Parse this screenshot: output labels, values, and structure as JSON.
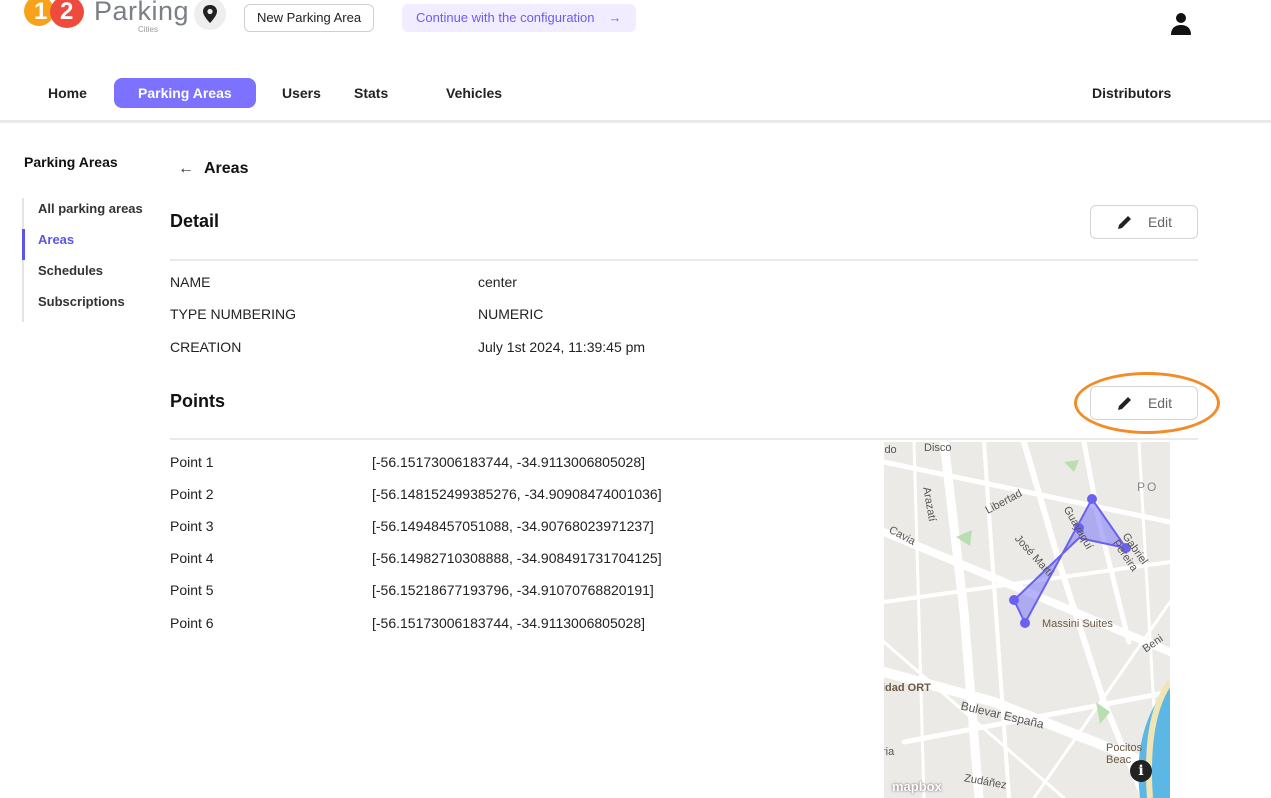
{
  "app": {
    "logo_digit_1": "1",
    "logo_digit_2": "2",
    "name": "Parking",
    "subtitle": "Cities",
    "new_area_label": "New Parking Area",
    "continue_label": "Continue with the configuration",
    "continue_arrow": "→"
  },
  "nav": {
    "items": [
      "Home",
      "Parking Areas",
      "Users",
      "Stats",
      "Vehicles"
    ],
    "right": "Distributors",
    "active": "Parking Areas"
  },
  "sidebar": {
    "title": "Parking Areas",
    "items": [
      "All parking areas",
      "Areas",
      "Schedules",
      "Subscriptions"
    ],
    "active": "Areas"
  },
  "main": {
    "back_arrow": "←",
    "back_label": "Areas",
    "detail": {
      "title": "Detail",
      "edit_label": "Edit",
      "fields": [
        {
          "key": "NAME",
          "value": "center"
        },
        {
          "key": "TYPE NUMBERING",
          "value": "NUMERIC"
        },
        {
          "key": "CREATION",
          "value": "July 1st 2024, 11:39:45 pm"
        }
      ]
    },
    "points": {
      "title": "Points",
      "edit_label": "Edit",
      "items": [
        {
          "label": "Point 1",
          "value": "[-56.15173006183744, -34.9113006805028]"
        },
        {
          "label": "Point 2",
          "value": "[-56.148152499385276, -34.90908474001036]"
        },
        {
          "label": "Point 3",
          "value": "[-56.14948457051088, -34.90768023971237]"
        },
        {
          "label": "Point 4",
          "value": "[-56.14982710308888, -34.908491731704125]"
        },
        {
          "label": "Point 5",
          "value": "[-56.15218677193796, -34.91070768820191]"
        },
        {
          "label": "Point 6",
          "value": "[-56.15173006183744, -34.9113006805028]"
        }
      ]
    }
  },
  "map": {
    "labels": {
      "disco": "Disco",
      "ido": "ido",
      "arazati": "Arazatí",
      "libertad": "Libertad",
      "po": "PO",
      "cavia": "Cavia",
      "guayaqui": "Guayaquí",
      "jose_marti": "José Martí",
      "gabriel_pereira": "Gabriel Pereira",
      "massini": "Massini Suites",
      "beni": "Beni",
      "ort": "idad ORT",
      "bulevar": "Bulevar España",
      "ria": "ria",
      "pocitos": "Pocitos Beac",
      "zudanez": "Zudáñez"
    },
    "logo": "mapbox",
    "info": "i",
    "polygon_color": "#7b74f5"
  },
  "colors": {
    "accent": "#7c72ff",
    "highlight_ring": "#f28c28"
  }
}
